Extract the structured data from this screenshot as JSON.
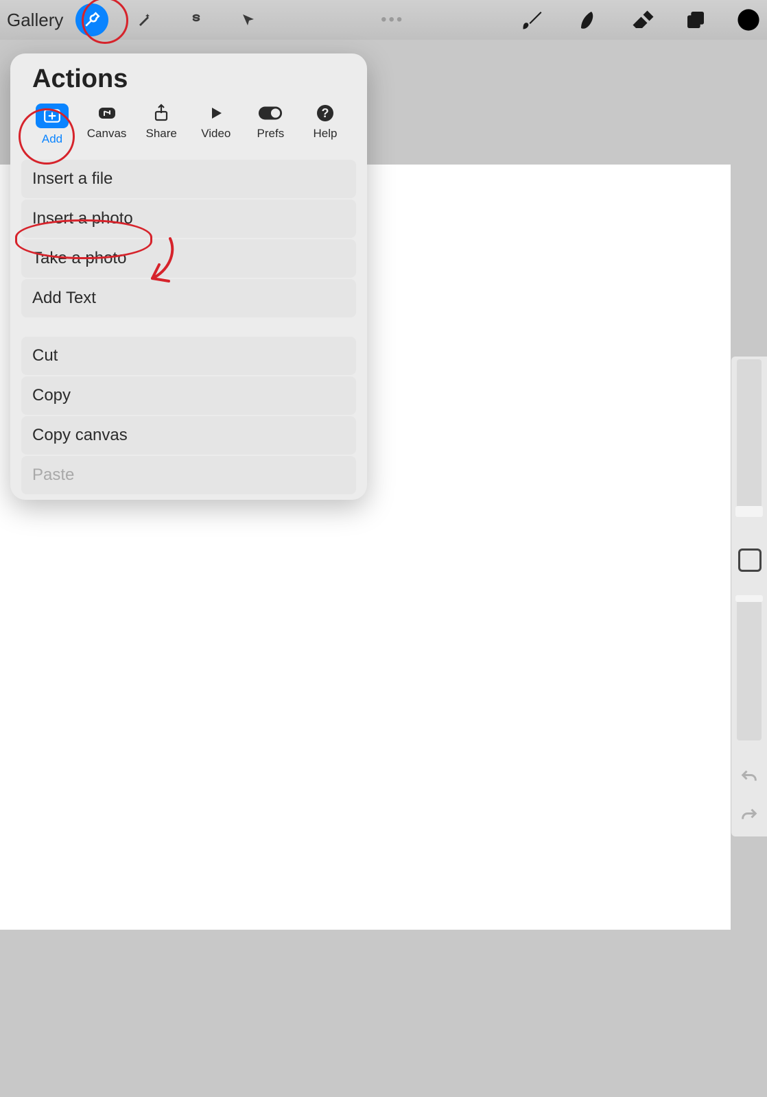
{
  "topbar": {
    "gallery_label": "Gallery",
    "modify_ellipsis": "•••"
  },
  "popover": {
    "title": "Actions",
    "tabs": [
      {
        "label": "Add"
      },
      {
        "label": "Canvas"
      },
      {
        "label": "Share"
      },
      {
        "label": "Video"
      },
      {
        "label": "Prefs"
      },
      {
        "label": "Help"
      }
    ],
    "group1": [
      "Insert a file",
      "Insert a photo",
      "Take a photo",
      "Add Text"
    ],
    "group2": [
      "Cut",
      "Copy",
      "Copy canvas",
      "Paste"
    ]
  },
  "colors": {
    "accent": "#0a84ff",
    "annotation": "#d6232b"
  }
}
